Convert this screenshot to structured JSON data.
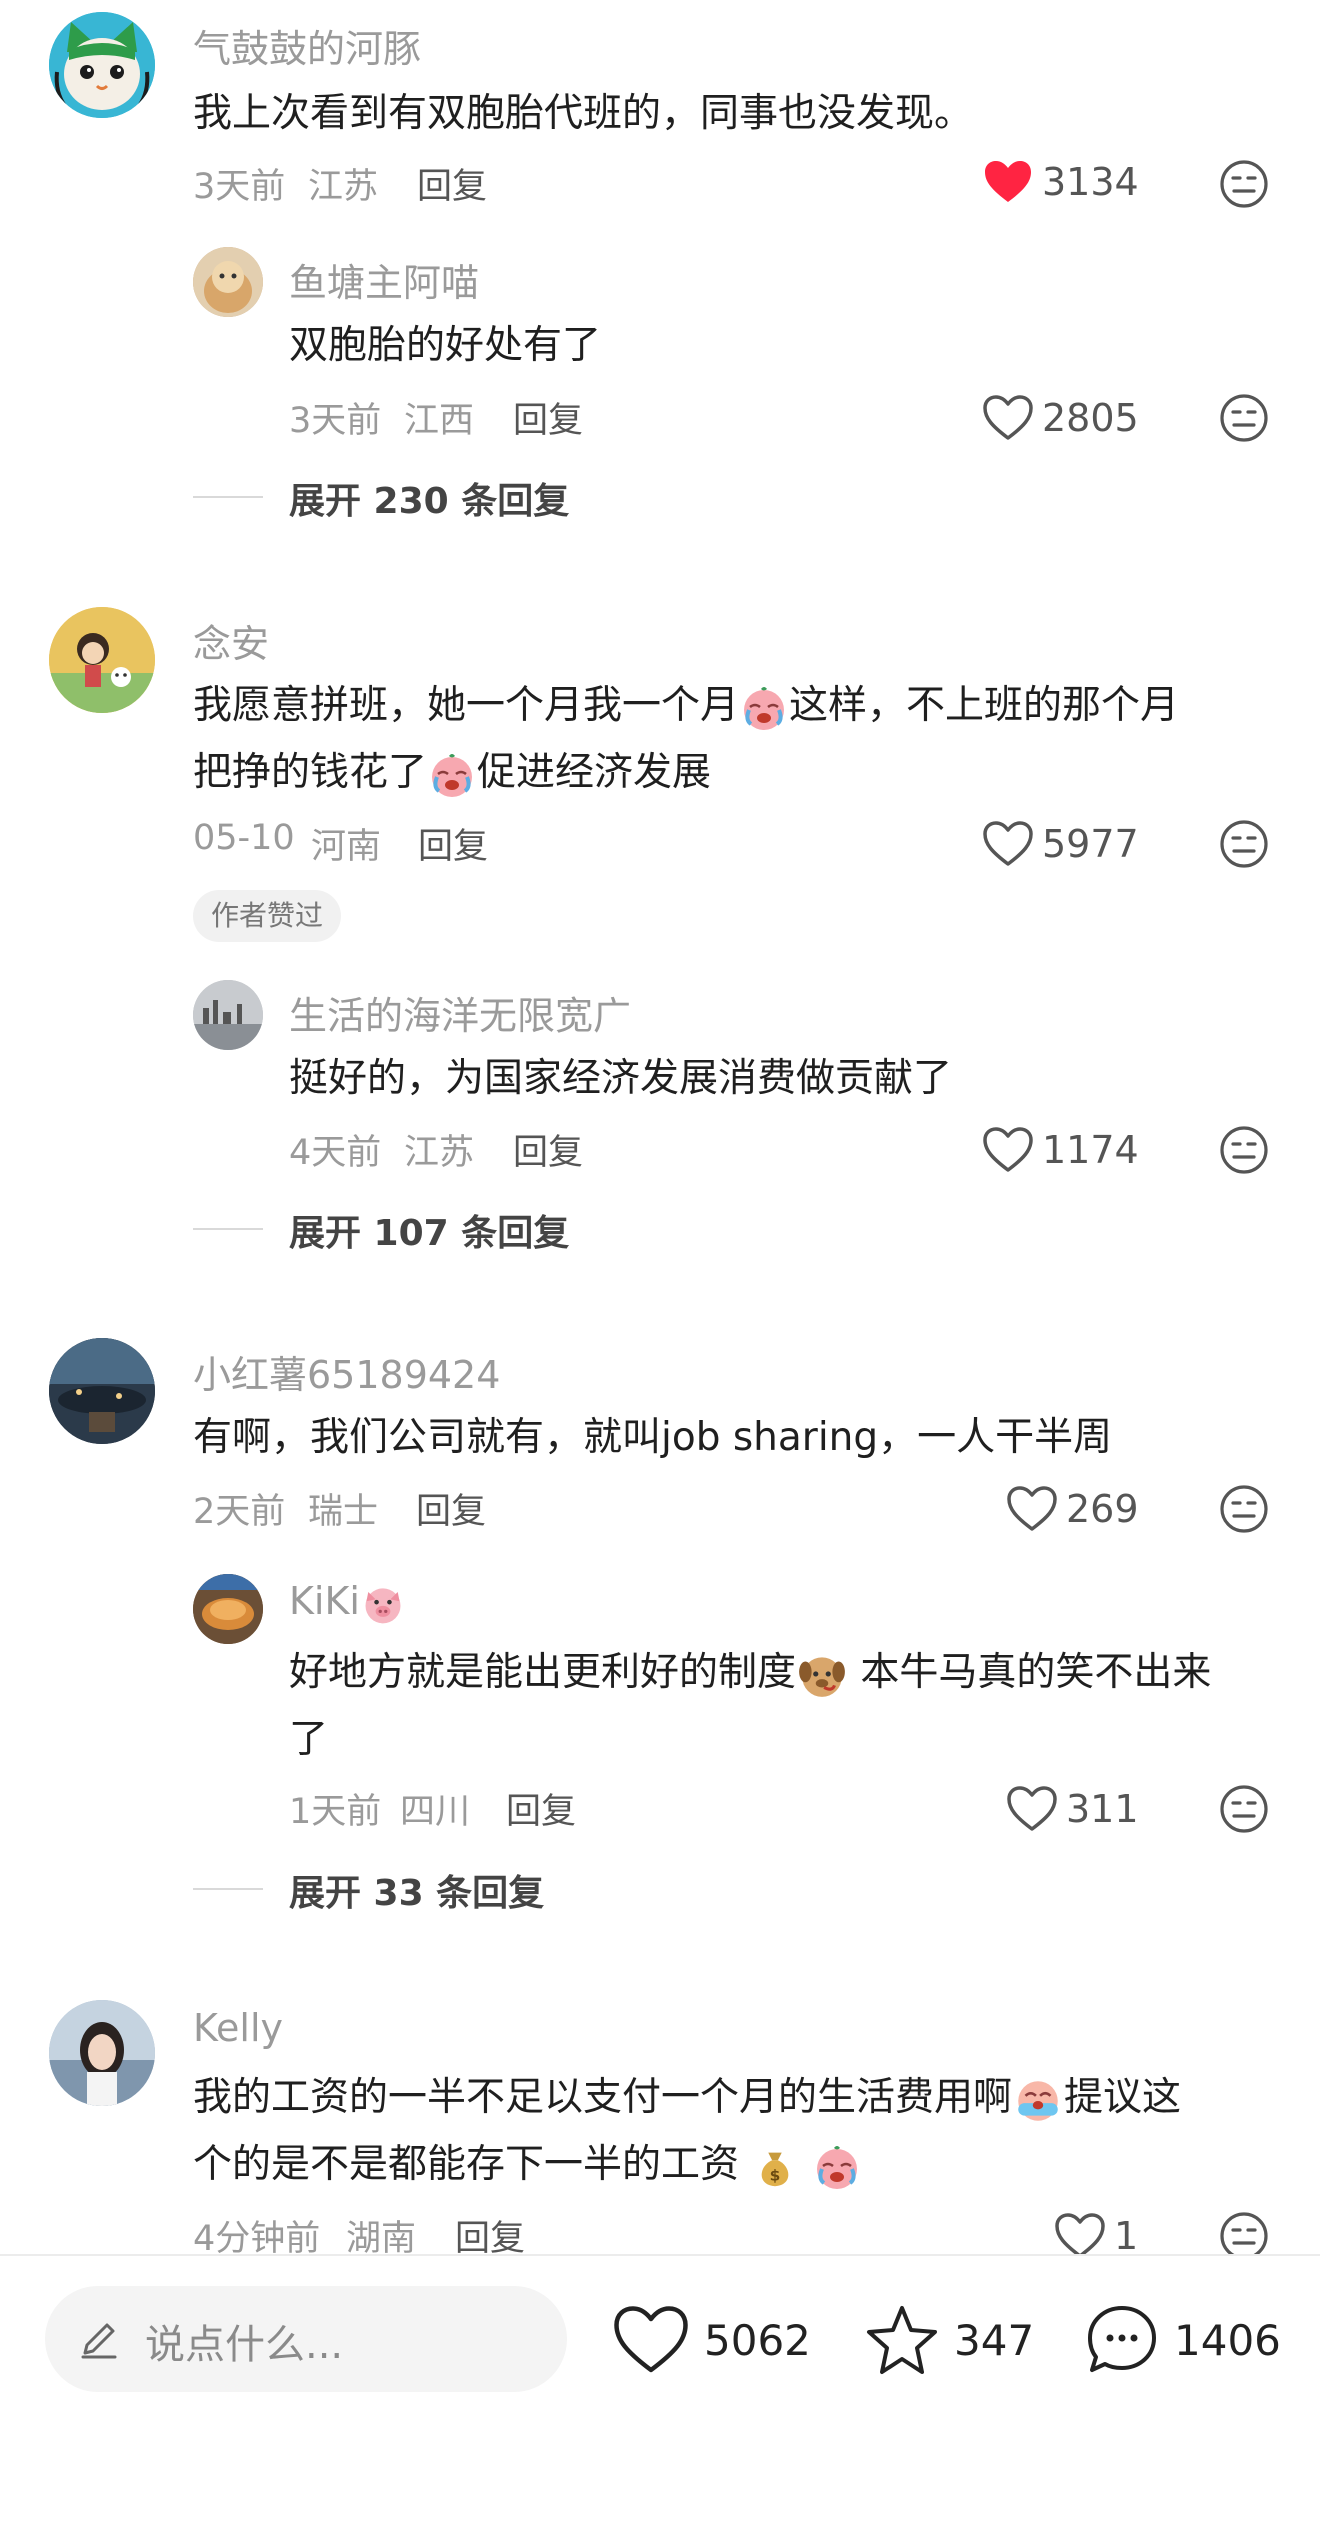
{
  "comments": [
    {
      "name": "气鼓鼓的河豚",
      "text": "我上次看到有双胞胎代班的，同事也没发现。",
      "time": "3天前",
      "location": "江苏",
      "reply_label": "回复",
      "likes": "3134",
      "liked": true,
      "sub_reply": {
        "name": "鱼塘主阿喵",
        "text": "双胞胎的好处有了",
        "time": "3天前",
        "location": "江西",
        "reply_label": "回复",
        "likes": "2805"
      },
      "expand_label": "展开 230 条回复"
    },
    {
      "name": "念安",
      "text_line1_a": "我愿意拼班，她一个月我一个月",
      "text_line1_b": "这样，不上班的那个月",
      "text_line2_a": "把挣的钱花了",
      "text_line2_b": "促进经济发展",
      "time": "05-10",
      "location": "河南",
      "reply_label": "回复",
      "likes": "5977",
      "author_tag": "作者赞过",
      "sub_reply": {
        "name": "生活的海洋无限宽广",
        "text": "挺好的，为国家经济发展消费做贡献了",
        "time": "4天前",
        "location": "江苏",
        "reply_label": "回复",
        "likes": "1174"
      },
      "expand_label": "展开 107 条回复"
    },
    {
      "name": "小红薯65189424",
      "text": "有啊，我们公司就有，就叫job sharing，一人干半周",
      "time": "2天前",
      "location": "瑞士",
      "reply_label": "回复",
      "likes": "269",
      "sub_reply": {
        "name": "KiKi",
        "text_line1_a": "好地方就是能出更利好的制度",
        "text_line1_b": " 本牛马真的笑不出来",
        "text_line2": "了",
        "time": "1天前",
        "location": "四川",
        "reply_label": "回复",
        "likes": "311"
      },
      "expand_label": "展开 33 条回复"
    },
    {
      "name": "Kelly",
      "text_line1_a": "我的工资的一半不足以支付一个月的生活费用啊",
      "text_line1_b": "提议这",
      "text_line2": "个的是不是都能存下一半的工资",
      "time": "4分钟前",
      "location": "湖南",
      "reply_label": "回复",
      "likes": "1"
    }
  ],
  "bottom_bar": {
    "input_placeholder": "说点什么...",
    "likes": "5062",
    "favorites": "347",
    "comments": "1406"
  },
  "colors": {
    "liked_heart": "#ff2442",
    "muted_text": "#9a9a9a"
  }
}
